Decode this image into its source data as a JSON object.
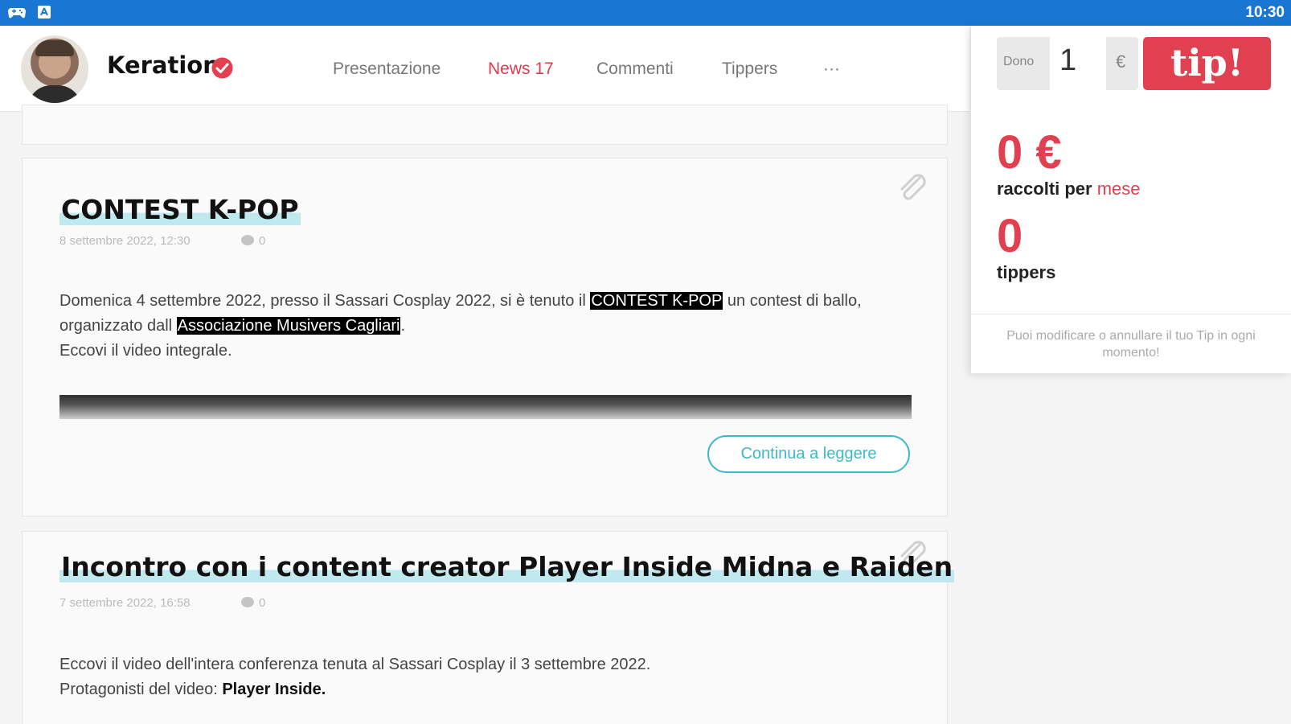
{
  "status_bar": {
    "time": "10:30",
    "icons": [
      "gamepad-icon",
      "app-store-icon"
    ]
  },
  "header": {
    "creator_name": "Keration",
    "nav": [
      {
        "label": "Presentazione"
      },
      {
        "label": "News 17"
      },
      {
        "label": "Commenti"
      },
      {
        "label": "Tippers"
      },
      {
        "label": "···"
      }
    ],
    "active_tab": "News 17"
  },
  "tip_panel": {
    "dono_label": "Dono",
    "amount": "1",
    "currency": "€",
    "tip_button": "tip!",
    "collected_value": "0 €",
    "collected_label": "raccolti per",
    "collected_period": "mese",
    "tippers_value": "0",
    "tippers_label": "tippers",
    "note": "Puoi modificare o annullare il tuo Tip in ogni momento!"
  },
  "posts": [
    {
      "title": "CONTEST K-POP",
      "date": "8 settembre 2022, 12:30",
      "comments": "0",
      "body": {
        "p1_a": "Domenica 4 settembre 2022, presso il Sassari Cosplay 2022, si è tenuto il ",
        "p1_hl1": "CONTEST K-POP",
        "p1_b": " un contest di ballo, organizzato dall ",
        "p1_hl2": "Associazione Musivers Cagliari",
        "p1_c": ".",
        "p2": "Eccovi il video integrale."
      },
      "read_more": "Continua a leggere"
    },
    {
      "title": "Incontro con i content creator Player Inside Midna e Raiden",
      "date": "7 settembre 2022, 16:58",
      "comments": "0",
      "body": {
        "p1": "Eccovi il video dell'intera conferenza tenuta al Sassari Cosplay il 3 settembre 2022.",
        "p2_a": "Protagonisti del video: ",
        "p2_b": "Player Inside."
      }
    }
  ],
  "colors": {
    "status_bar": "#1976d2",
    "accent": "#e0404f",
    "link": "#3fb8c9",
    "title_highlight": "#bfe9ee"
  }
}
